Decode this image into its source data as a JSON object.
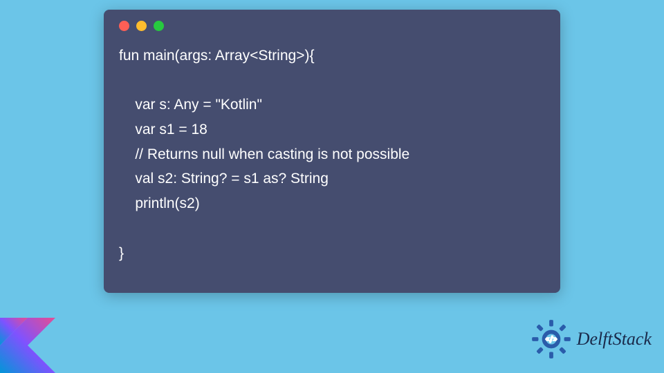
{
  "code": {
    "line1": "fun main(args: Array<String>){",
    "line2": "",
    "line3": "    var s: Any = \"Kotlin\"",
    "line4": "    var s1 = 18",
    "line5": "    // Returns null when casting is not possible",
    "line6": "    val s2: String? = s1 as? String",
    "line7": "    println(s2)",
    "line8": "",
    "line9": "}"
  },
  "brand": {
    "name": "DelftStack"
  },
  "window": {
    "dots": [
      "red",
      "yellow",
      "green"
    ]
  }
}
